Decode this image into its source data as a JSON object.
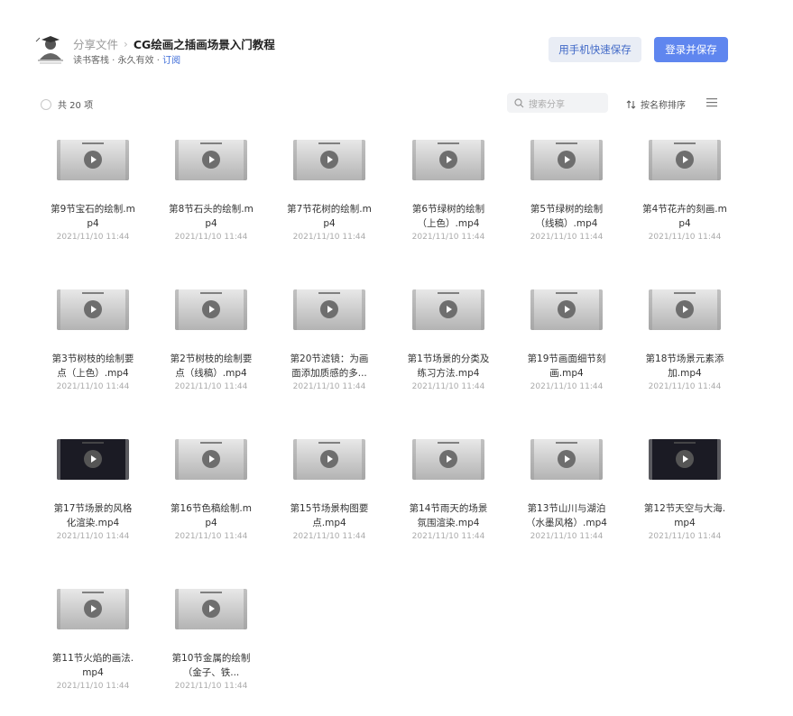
{
  "header": {
    "breadcrumb_root": "分享文件",
    "breadcrumb_sep": "›",
    "title": "CG绘画之插画场景入门教程",
    "meta_text": "读书客栈 · 永久有效 · ",
    "subscribe_label": "订阅",
    "mobile_save_label": "用手机快速保存",
    "login_save_label": "登录并保存"
  },
  "toolbar": {
    "count_label": "共 20 项",
    "search_placeholder": "搜索分享",
    "sort_label": "按名称排序"
  },
  "files": [
    {
      "name": "第9节宝石的绘制.mp4",
      "date": "2021/11/10 11:44",
      "thumb": "light"
    },
    {
      "name": "第8节石头的绘制.mp4",
      "date": "2021/11/10 11:44",
      "thumb": "light"
    },
    {
      "name": "第7节花树的绘制.mp4",
      "date": "2021/11/10 11:44",
      "thumb": "light"
    },
    {
      "name": "第6节绿树的绘制（上色）.mp4",
      "date": "2021/11/10 11:44",
      "thumb": "light"
    },
    {
      "name": "第5节绿树的绘制（线稿）.mp4",
      "date": "2021/11/10 11:44",
      "thumb": "light"
    },
    {
      "name": "第4节花卉的刻画.mp4",
      "date": "2021/11/10 11:44",
      "thumb": "light"
    },
    {
      "name": "第3节树枝的绘制要点（上色）.mp4",
      "date": "2021/11/10 11:44",
      "thumb": "light"
    },
    {
      "name": "第2节树枝的绘制要点（线稿）.mp4",
      "date": "2021/11/10 11:44",
      "thumb": "light"
    },
    {
      "name": "第20节滤镜：为画面添加质感的多...",
      "date": "2021/11/10 11:44",
      "thumb": "light"
    },
    {
      "name": "第1节场景的分类及练习方法.mp4",
      "date": "2021/11/10 11:44",
      "thumb": "light"
    },
    {
      "name": "第19节画面细节刻画.mp4",
      "date": "2021/11/10 11:44",
      "thumb": "light"
    },
    {
      "name": "第18节场景元素添加.mp4",
      "date": "2021/11/10 11:44",
      "thumb": "light"
    },
    {
      "name": "第17节场景的风格化渲染.mp4",
      "date": "2021/11/10 11:44",
      "thumb": "dark"
    },
    {
      "name": "第16节色稿绘制.mp4",
      "date": "2021/11/10 11:44",
      "thumb": "light"
    },
    {
      "name": "第15节场景构图要点.mp4",
      "date": "2021/11/10 11:44",
      "thumb": "light"
    },
    {
      "name": "第14节雨天的场景氛围渲染.mp4",
      "date": "2021/11/10 11:44",
      "thumb": "light"
    },
    {
      "name": "第13节山川与湖泊（水墨风格）.mp4",
      "date": "2021/11/10 11:44",
      "thumb": "light"
    },
    {
      "name": "第12节天空与大海.mp4",
      "date": "2021/11/10 11:44",
      "thumb": "dark"
    },
    {
      "name": "第11节火焰的画法.mp4",
      "date": "2021/11/10 11:44",
      "thumb": "light"
    },
    {
      "name": "第10节金属的绘制（金子、铁...",
      "date": "2021/11/10 11:44",
      "thumb": "light"
    }
  ]
}
